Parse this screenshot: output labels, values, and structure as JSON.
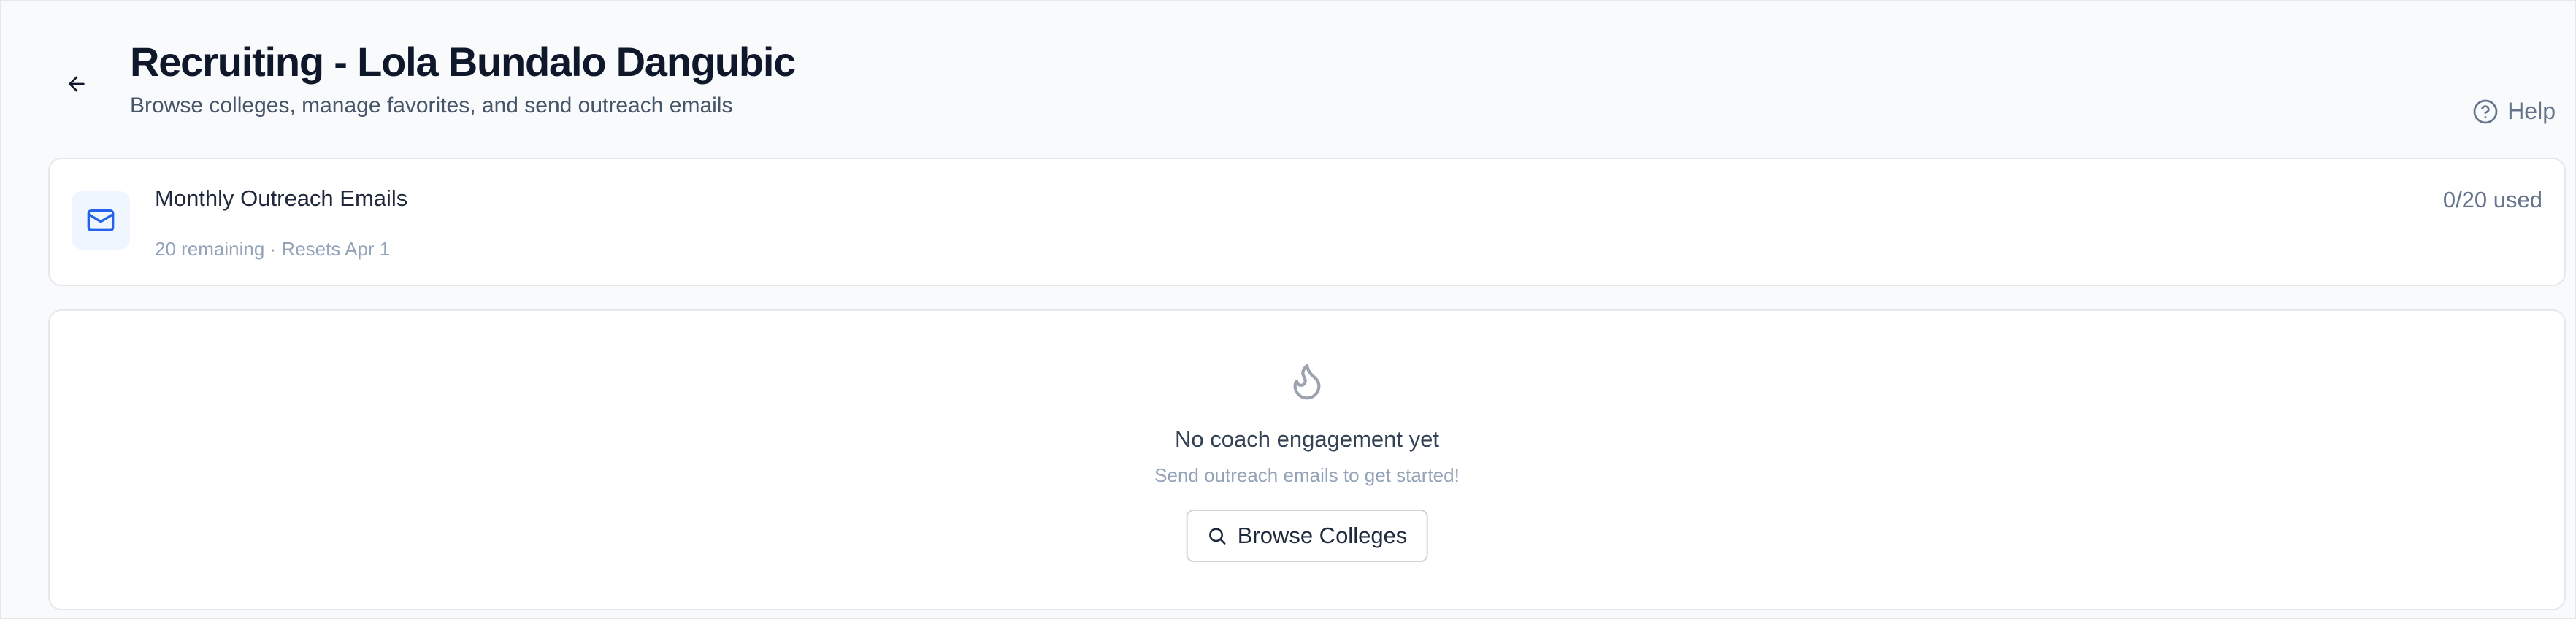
{
  "header": {
    "title": "Recruiting - Lola Bundalo Dangubic",
    "subtitle": "Browse colleges, manage favorites, and send outreach emails",
    "help_label": "Help"
  },
  "outreach": {
    "title": "Monthly Outreach Emails",
    "meta": "20 remaining · Resets Apr 1",
    "usage": "0/20 used",
    "used": 0,
    "limit": 20
  },
  "engagement": {
    "empty_title": "No coach engagement yet",
    "empty_subtitle": "Send outreach emails to get started!",
    "browse_label": "Browse Colleges"
  },
  "icons": {
    "back": "arrow-left-icon",
    "help": "question-circle-icon",
    "mail": "mail-icon",
    "flame": "flame-icon",
    "search": "search-icon"
  },
  "colors": {
    "accent": "#2563eb",
    "accent_bg": "#eff6ff",
    "page_bg": "#f8fafc"
  }
}
